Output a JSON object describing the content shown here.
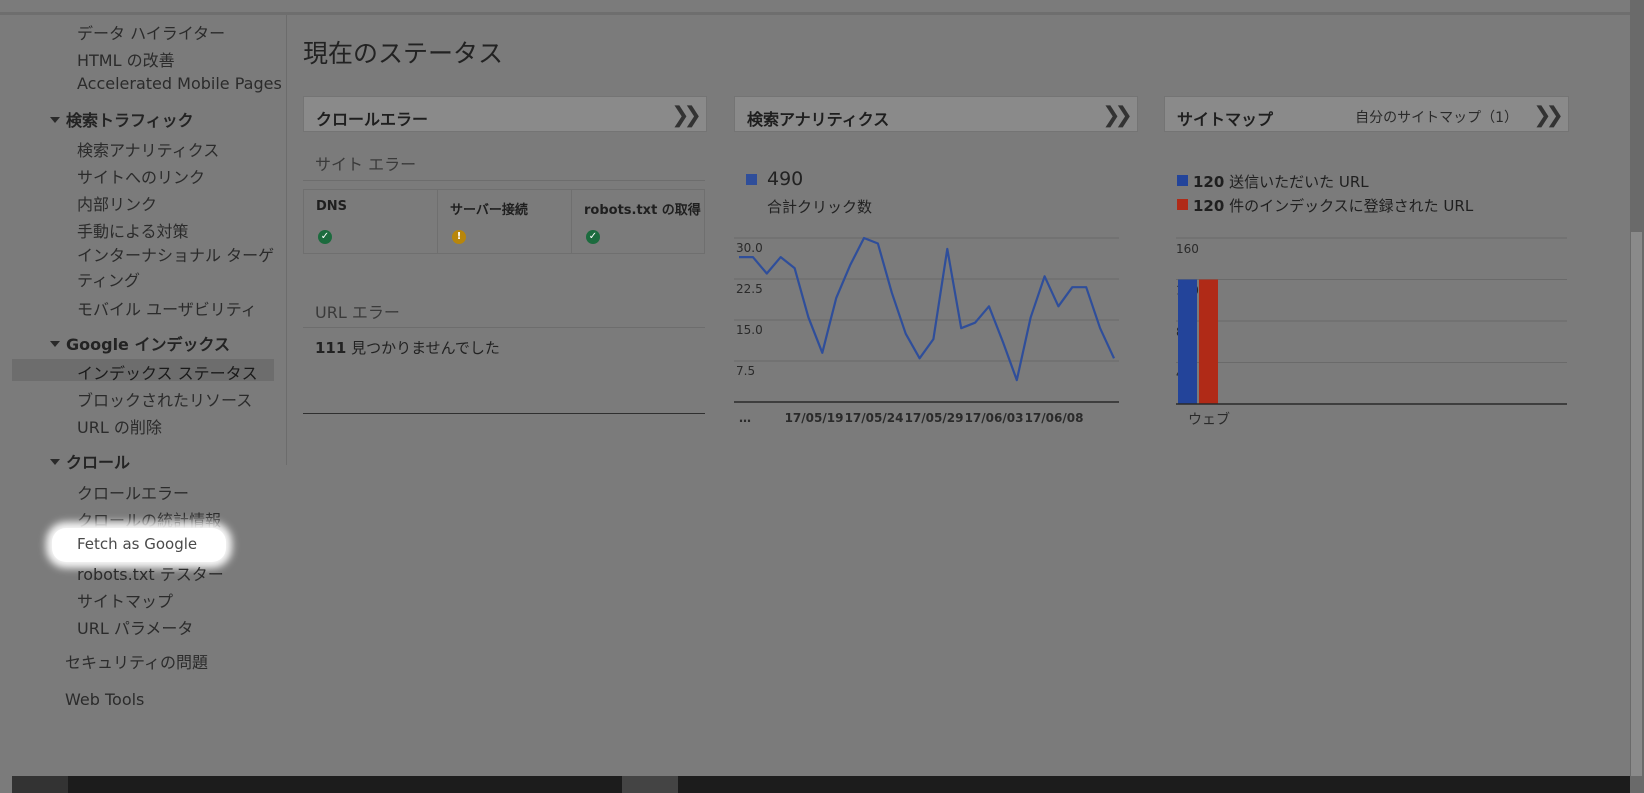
{
  "sidebar": {
    "items_top": [
      "データ ハイライター",
      "HTML の改善",
      "Accelerated Mobile Pages"
    ],
    "section_traffic": "検索トラフィック",
    "traffic_items": [
      "検索アナリティクス",
      "サイトへのリンク",
      "内部リンク",
      "手動による対策",
      "インターナショナル ターゲティング",
      "モバイル ユーザビリティ"
    ],
    "section_index": "Google インデックス",
    "index_items": [
      "インデックス ステータス",
      "ブロックされたリソース",
      "URL の削除"
    ],
    "section_crawl": "クロール",
    "crawl_items": [
      "クロールエラー",
      "クロールの統計情報",
      "Fetch as Google",
      "robots.txt テスター",
      "サイトマップ",
      "URL パラメータ"
    ],
    "security": "セキュリティの問題",
    "web_tools": "Web Tools"
  },
  "main": {
    "title": "現在のステータス",
    "crawl_card": {
      "title": "クロールエラー",
      "site_errors_label": "サイト エラー",
      "columns": [
        {
          "label": "DNS",
          "status": "ok"
        },
        {
          "label": "サーバー接続",
          "status": "warning"
        },
        {
          "label": "robots.txt の取得",
          "status": "ok"
        }
      ],
      "url_errors_label": "URL エラー",
      "url_error_count": "111",
      "url_error_text": "見つかりませんでした"
    },
    "analytics_card": {
      "title": "検索アナリティクス",
      "total": "490",
      "total_label": "合計クリック数"
    },
    "sitemap_card": {
      "title": "サイトマップ",
      "link": "自分のサイトマップ（1）",
      "legend": [
        {
          "count": "120",
          "text": "送信いただいた URL",
          "color": "#23449a"
        },
        {
          "count": "120",
          "text": "件のインデックスに登録された URL",
          "color": "#b02a17"
        }
      ]
    }
  },
  "chart_data": [
    {
      "type": "line",
      "title": "",
      "series": [
        {
          "values": [
            26.5,
            26.5,
            23.5,
            26.5,
            24.5,
            15.5,
            9,
            19,
            25,
            30,
            29,
            20,
            12.5,
            8,
            11.5,
            28,
            13.5,
            14.5,
            17.5,
            11,
            4,
            15.5,
            23,
            17.5,
            21,
            21,
            13.5,
            8
          ]
        }
      ],
      "x_tick_labels": [
        "…",
        "17/05/19",
        "17/05/24",
        "17/05/29",
        "17/06/03",
        "17/06/08"
      ],
      "y_ticks": [
        "7.5",
        "15.0",
        "22.5",
        "30.0"
      ],
      "ylim": [
        0,
        30
      ],
      "color": "#2f4e9a"
    },
    {
      "type": "bar",
      "title": "",
      "categories": [
        "ウェブ"
      ],
      "series": [
        {
          "name": "送信いただいた URL",
          "values": [
            120
          ],
          "color": "#23449a"
        },
        {
          "name": "件のインデックスに登録された URL",
          "values": [
            120
          ],
          "color": "#b02a17"
        }
      ],
      "y_ticks": [
        "40",
        "80",
        "120",
        "160"
      ],
      "ylim": [
        0,
        160
      ]
    }
  ]
}
